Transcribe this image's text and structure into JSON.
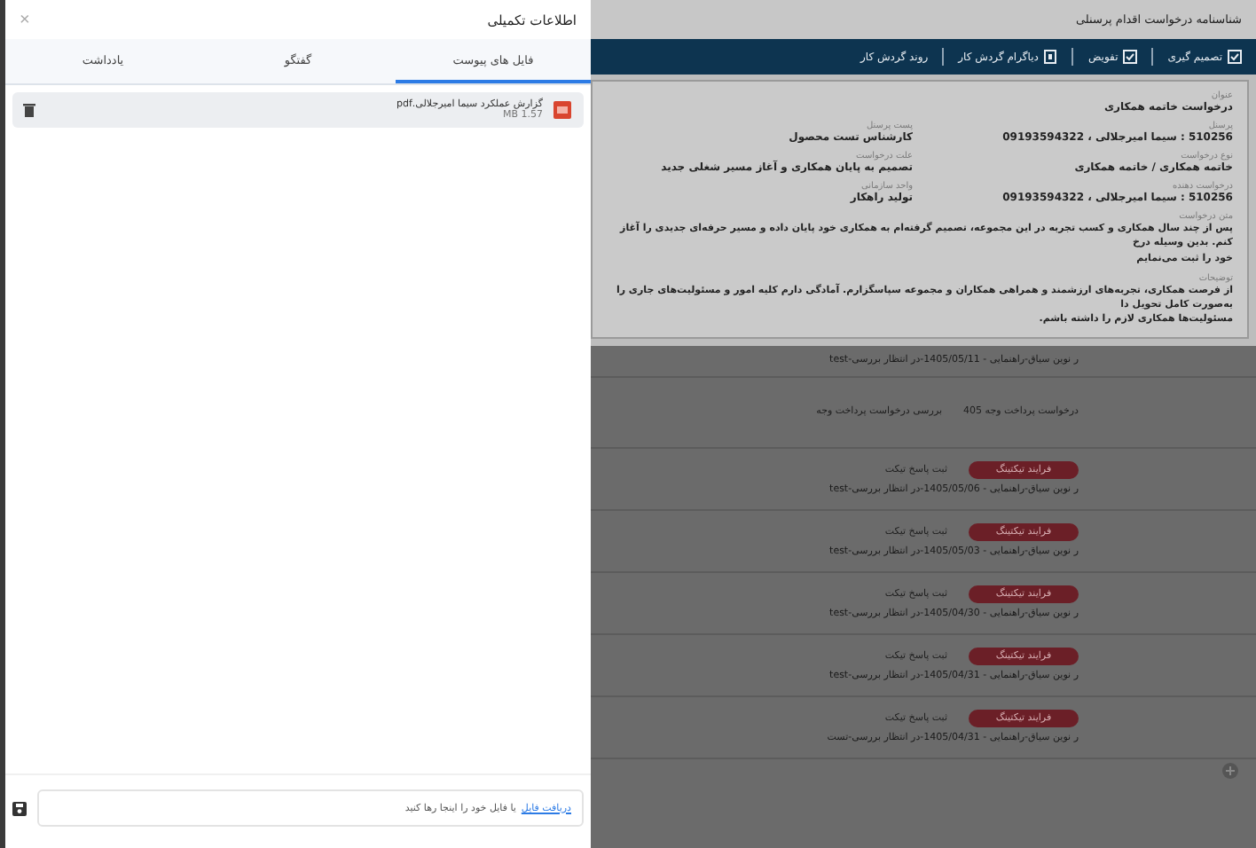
{
  "drawer": {
    "title": "اطلاعات تکمیلی",
    "close": "×",
    "tabs": [
      {
        "label": "فایل های پیوست",
        "selected": true
      },
      {
        "label": "گفتگو",
        "selected": false
      },
      {
        "label": "یادداشت",
        "selected": false
      }
    ],
    "files": [
      {
        "name": "گزارش عملکرد سیما امیرجلالی.pdf",
        "size": "MB 1.57"
      }
    ],
    "upload": {
      "link": "دریافت فایل",
      "text": "یا فایل خود را اینجا رها کنید"
    }
  },
  "modal": {
    "title": "شناسنامه درخواست اقدام پرسنلی",
    "toolbar": [
      {
        "label": "تصمیم گیری",
        "kind": "check"
      },
      {
        "label": "تفویض",
        "kind": "check"
      },
      {
        "label": "دیاگرام گردش کار",
        "kind": "diagram"
      },
      {
        "label": "روند گردش کار",
        "kind": "plain"
      }
    ],
    "title_field": {
      "label": "عنوان",
      "value": "درخواست خاتمه همکاری"
    },
    "fields": [
      [
        {
          "label": "پرسنل",
          "value": "510256 : سیما امیرجلالی ، 09193594322"
        },
        {
          "label": "پست پرسنل",
          "value": "کارشناس تست محصول"
        }
      ],
      [
        {
          "label": "نوع درخواست",
          "value": "خاتمه همکاری / خاتمه همکاری"
        },
        {
          "label": "علت درخواست",
          "value": "تصمیم به پایان همکاری و آغاز مسیر شغلی جدید"
        }
      ],
      [
        {
          "label": "درخواست دهنده",
          "value": "510256 : سیما امیرجلالی ، 09193594322"
        },
        {
          "label": "واحد سازمانی",
          "value": "تولید راهکار"
        }
      ]
    ],
    "paragraphs": [
      {
        "label": "متن درخواست",
        "lines": [
          "پس از چند سال همکاری و کسب تجربه در این مجموعه، تصمیم گرفته‌ام به همکاری خود پایان داده و مسیر حرفه‌ای جدیدی را آغاز کنم. بدین وسیله درخ",
          "خود را ثبت می‌نمایم"
        ]
      },
      {
        "label": "توضیحات",
        "lines": [
          "از فرصت همکاری، تجربه‌های ارزشمند و همراهی همکاران و مجموعه سپاسگزارم. آمادگی دارم کلیه امور و مسئولیت‌های جاری را به‌صورت کامل تحویل دا",
          "مسئولیت‌ها همکاری لازم را داشته باشم."
        ]
      }
    ]
  },
  "list": {
    "rows": [
      {
        "kind": "note",
        "subtitle": "ر نوین سیاق-راهنمایی - 1405/05/11-در انتظار بررسی-test"
      },
      {
        "kind": "payment",
        "title": "درخواست پرداخت وجه 405",
        "status": "بررسی درخواست پرداخت وجه"
      },
      {
        "kind": "ticket",
        "badge": "فرایند تیکتینگ",
        "status": "ثبت پاسخ تیکت",
        "subtitle": "ر نوین سیاق-راهنمایی - 1405/05/06-در انتظار بررسی-test"
      },
      {
        "kind": "ticket",
        "badge": "فرایند تیکتینگ",
        "status": "ثبت پاسخ تیکت",
        "subtitle": "ر نوین سیاق-راهنمایی - 1405/05/03-در انتظار بررسی-test"
      },
      {
        "kind": "ticket",
        "badge": "فرایند تیکتینگ",
        "status": "ثبت پاسخ تیکت",
        "subtitle": "ر نوین سیاق-راهنمایی - 1405/04/30-در انتظار بررسی-test"
      },
      {
        "kind": "ticket",
        "badge": "فرایند تیکتینگ",
        "status": "ثبت پاسخ تیکت",
        "subtitle": "ر نوین سیاق-راهنمایی - 1405/04/31-در انتظار بررسی-test"
      },
      {
        "kind": "ticket",
        "badge": "فرایند تیکتینگ",
        "status": "ثبت پاسخ تیکت",
        "subtitle": "ر نوین سیاق-راهنمایی - 1405/04/31-در انتظار بررسی-تست"
      }
    ]
  }
}
